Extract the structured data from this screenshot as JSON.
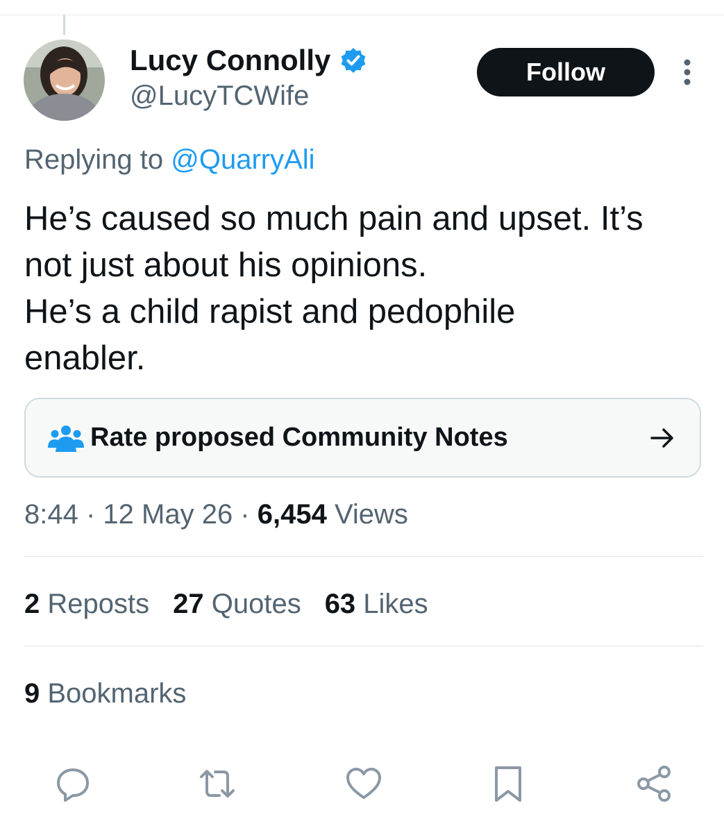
{
  "author": {
    "display_name": "Lucy Connolly",
    "handle": "@LucyTCWife",
    "verified": true,
    "avatar_icon": "profile-photo"
  },
  "follow_label": "Follow",
  "reply": {
    "prefix": "Replying to ",
    "mention": "@QuarryAli"
  },
  "tweet_lines": [
    "He’s caused so much pain and upset. It’s",
    "not just about his opinions.",
    "He’s a child rapist and pedophile",
    "enabler."
  ],
  "community_notes": {
    "label": "Rate proposed Community Notes",
    "icon": "people-icon"
  },
  "meta": {
    "time": "8:44",
    "date": "12 May 26",
    "separator": " · ",
    "views_count": "6,454",
    "views_label": " Views"
  },
  "stats": {
    "reposts_count": "2",
    "reposts_label": " Reposts",
    "quotes_count": "27",
    "quotes_label": " Quotes",
    "likes_count": "63",
    "likes_label": " Likes",
    "bookmarks_count": "9",
    "bookmarks_label": " Bookmarks"
  },
  "actions": [
    "reply-icon",
    "repost-icon",
    "like-icon",
    "bookmark-icon",
    "share-icon"
  ],
  "colors": {
    "text_primary": "#0f1419",
    "text_secondary": "#536471",
    "link": "#1d9bf0",
    "verified": "#1d9bf0",
    "follow_bg": "#0f1419"
  }
}
